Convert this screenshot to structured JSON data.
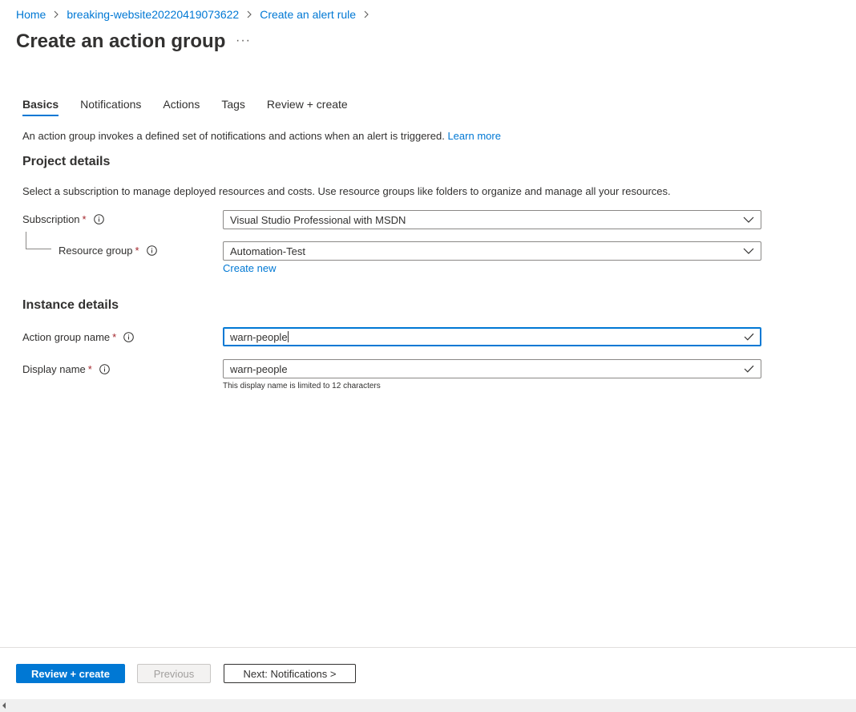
{
  "breadcrumb": {
    "items": [
      "Home",
      "breaking-website20220419073622",
      "Create an alert rule"
    ]
  },
  "page": {
    "title": "Create an action group",
    "more": "···"
  },
  "tabs": [
    {
      "label": "Basics",
      "active": true
    },
    {
      "label": "Notifications",
      "active": false
    },
    {
      "label": "Actions",
      "active": false
    },
    {
      "label": "Tags",
      "active": false
    },
    {
      "label": "Review + create",
      "active": false
    }
  ],
  "intro": {
    "text": "An action group invokes a defined set of notifications and actions when an alert is triggered.",
    "link": "Learn more"
  },
  "project": {
    "title": "Project details",
    "description": "Select a subscription to manage deployed resources and costs. Use resource groups like folders to organize and manage all your resources.",
    "subscription_label": "Subscription",
    "subscription_value": "Visual Studio Professional with MSDN",
    "resource_group_label": "Resource group",
    "resource_group_value": "Automation-Test",
    "create_new": "Create new"
  },
  "instance": {
    "title": "Instance details",
    "action_group_name_label": "Action group name",
    "action_group_name_value": "warn-people",
    "display_name_label": "Display name",
    "display_name_value": "warn-people",
    "display_name_hint": "This display name is limited to 12 characters"
  },
  "required_marker": "*",
  "footer": {
    "review_create": "Review + create",
    "previous": "Previous",
    "next": "Next: Notifications >"
  },
  "colors": {
    "accent": "#0078d4",
    "required": "#a4262c",
    "text": "#323130"
  }
}
